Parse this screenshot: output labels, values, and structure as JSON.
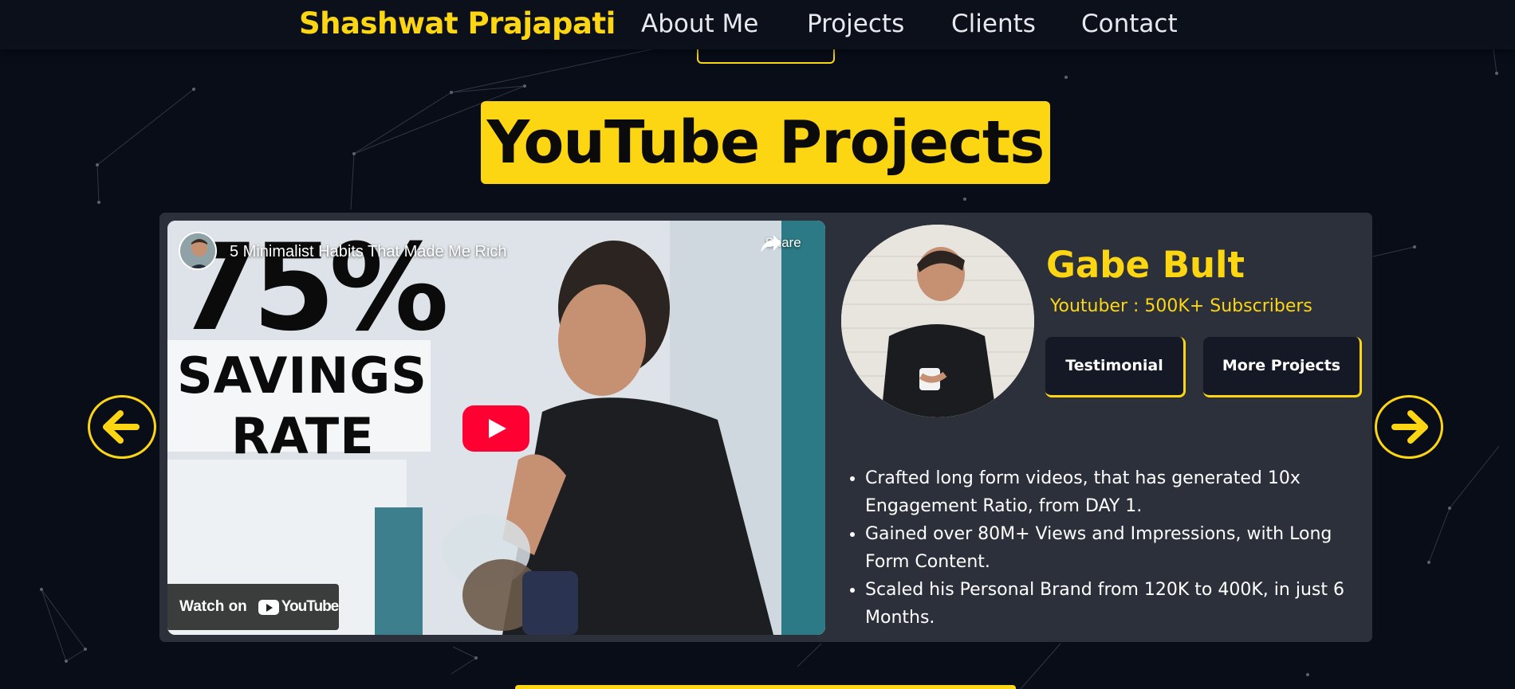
{
  "nav": {
    "brand": "Shashwat Prajapati",
    "links": [
      "About Me",
      "Projects",
      "Clients",
      "Contact"
    ]
  },
  "section": {
    "title": "YouTube Projects"
  },
  "video": {
    "title": "5 Minimalist Habits That Made Me Rich",
    "share_label": "Share",
    "thumbnail_big_text": "75%",
    "thumbnail_line1": "SAVINGS",
    "thumbnail_line2": "RATE",
    "watch_on_label": "Watch on",
    "youtube_logo_text": "YouTube"
  },
  "client": {
    "name": "Gabe Bult",
    "subtitle": "Youtuber : 500K+ Subscribers",
    "testimonial_label": "Testimonial",
    "more_projects_label": "More Projects",
    "bullets": [
      "Crafted long form videos, that has generated 10x Engagement Ratio, from DAY 1.",
      "Gained over 80M+ Views and Impressions, with Long Form Content.",
      "Scaled his Personal Brand from 120K to 400K, in just 6 Months."
    ]
  },
  "colors": {
    "accent": "#fcd613",
    "background": "#080d18",
    "card": "#2c303b",
    "youtube_red": "#ff0033"
  },
  "icons": {
    "prev": "arrow-left-icon",
    "next": "arrow-right-icon",
    "share": "share-icon",
    "play": "play-icon"
  }
}
